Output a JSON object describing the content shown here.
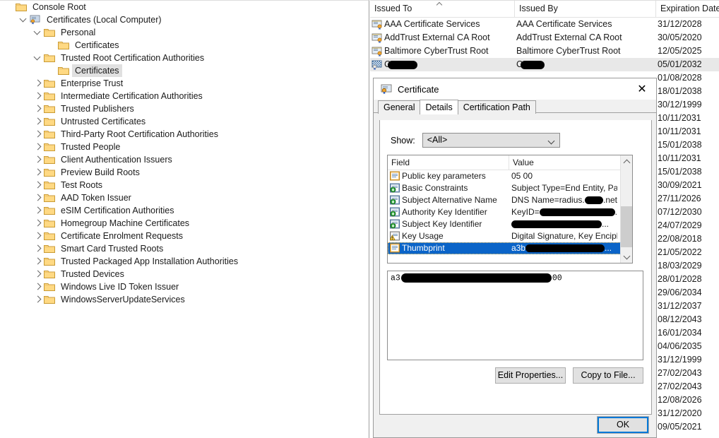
{
  "tree": {
    "items": [
      {
        "label": "Console Root",
        "depth": 0,
        "toggle": "none",
        "icon": "folder-icon",
        "selected": false
      },
      {
        "label": "Certificates (Local Computer)",
        "depth": 1,
        "toggle": "expanded",
        "icon": "console-certificates-icon",
        "selected": false
      },
      {
        "label": "Personal",
        "depth": 2,
        "toggle": "expanded",
        "icon": "folder-icon",
        "selected": false
      },
      {
        "label": "Certificates",
        "depth": 3,
        "toggle": "none",
        "icon": "folder-icon",
        "selected": false
      },
      {
        "label": "Trusted Root Certification Authorities",
        "depth": 2,
        "toggle": "expanded",
        "icon": "folder-icon",
        "selected": false
      },
      {
        "label": "Certificates",
        "depth": 3,
        "toggle": "none",
        "icon": "folder-icon",
        "selected": true
      },
      {
        "label": "Enterprise Trust",
        "depth": 2,
        "toggle": "collapsed",
        "icon": "folder-icon",
        "selected": false
      },
      {
        "label": "Intermediate Certification Authorities",
        "depth": 2,
        "toggle": "collapsed",
        "icon": "folder-icon",
        "selected": false
      },
      {
        "label": "Trusted Publishers",
        "depth": 2,
        "toggle": "collapsed",
        "icon": "folder-icon",
        "selected": false
      },
      {
        "label": "Untrusted Certificates",
        "depth": 2,
        "toggle": "collapsed",
        "icon": "folder-icon",
        "selected": false
      },
      {
        "label": "Third-Party Root Certification Authorities",
        "depth": 2,
        "toggle": "collapsed",
        "icon": "folder-icon",
        "selected": false
      },
      {
        "label": "Trusted People",
        "depth": 2,
        "toggle": "collapsed",
        "icon": "folder-icon",
        "selected": false
      },
      {
        "label": "Client Authentication Issuers",
        "depth": 2,
        "toggle": "collapsed",
        "icon": "folder-icon",
        "selected": false
      },
      {
        "label": "Preview Build Roots",
        "depth": 2,
        "toggle": "collapsed",
        "icon": "folder-icon",
        "selected": false
      },
      {
        "label": "Test Roots",
        "depth": 2,
        "toggle": "collapsed",
        "icon": "folder-icon",
        "selected": false
      },
      {
        "label": "AAD Token Issuer",
        "depth": 2,
        "toggle": "collapsed",
        "icon": "folder-icon",
        "selected": false
      },
      {
        "label": "eSIM Certification Authorities",
        "depth": 2,
        "toggle": "collapsed",
        "icon": "folder-icon",
        "selected": false
      },
      {
        "label": "Homegroup Machine Certificates",
        "depth": 2,
        "toggle": "collapsed",
        "icon": "folder-icon",
        "selected": false
      },
      {
        "label": "Certificate Enrolment Requests",
        "depth": 2,
        "toggle": "collapsed",
        "icon": "folder-icon",
        "selected": false
      },
      {
        "label": "Smart Card Trusted Roots",
        "depth": 2,
        "toggle": "collapsed",
        "icon": "folder-icon",
        "selected": false
      },
      {
        "label": "Trusted Packaged App Installation Authorities",
        "depth": 2,
        "toggle": "collapsed",
        "icon": "folder-icon",
        "selected": false
      },
      {
        "label": "Trusted Devices",
        "depth": 2,
        "toggle": "collapsed",
        "icon": "folder-icon",
        "selected": false
      },
      {
        "label": "Windows Live ID Token Issuer",
        "depth": 2,
        "toggle": "collapsed",
        "icon": "folder-icon",
        "selected": false
      },
      {
        "label": "WindowsServerUpdateServices",
        "depth": 2,
        "toggle": "collapsed",
        "icon": "folder-icon",
        "selected": false
      }
    ]
  },
  "list": {
    "columns": [
      "Issued To",
      "Issued By",
      "Expiration Date"
    ],
    "sort_column": "Issued To",
    "sort_direction": "ascending",
    "rows": [
      {
        "issued_to": "AAA Certificate Services",
        "issued_by": "AAA Certificate Services",
        "expiration": "31/12/2028",
        "selected": false,
        "redacted": false
      },
      {
        "issued_to": "AddTrust External CA Root",
        "issued_by": "AddTrust External CA Root",
        "expiration": "30/05/2020",
        "selected": false,
        "redacted": false
      },
      {
        "issued_to": "Baltimore CyberTrust Root",
        "issued_by": "Baltimore CyberTrust Root",
        "expiration": "12/05/2025",
        "selected": false,
        "redacted": false
      },
      {
        "issued_to": "C",
        "issued_by": "C",
        "expiration": "05/01/2032",
        "selected": true,
        "redacted": true
      },
      {
        "issued_to": "",
        "issued_by": "",
        "expiration": "01/08/2028",
        "selected": false,
        "redacted": false
      },
      {
        "issued_to": "",
        "issued_by": "",
        "expiration": "18/01/2038",
        "selected": false,
        "redacted": false
      },
      {
        "issued_to": "",
        "issued_by": "",
        "expiration": "30/12/1999",
        "selected": false,
        "redacted": false
      },
      {
        "issued_to": "",
        "issued_by": "",
        "expiration": "10/11/2031",
        "selected": false,
        "redacted": false
      },
      {
        "issued_to": "",
        "issued_by": "",
        "expiration": "10/11/2031",
        "selected": false,
        "redacted": false
      },
      {
        "issued_to": "",
        "issued_by": "",
        "expiration": "15/01/2038",
        "selected": false,
        "redacted": false
      },
      {
        "issued_to": "",
        "issued_by": "",
        "expiration": "10/11/2031",
        "selected": false,
        "redacted": false
      },
      {
        "issued_to": "",
        "issued_by": "",
        "expiration": "15/01/2038",
        "selected": false,
        "redacted": false
      },
      {
        "issued_to": "",
        "issued_by": "",
        "expiration": "30/09/2021",
        "selected": false,
        "redacted": false
      },
      {
        "issued_to": "",
        "issued_by": "",
        "expiration": "27/11/2026",
        "selected": false,
        "redacted": false
      },
      {
        "issued_to": "",
        "issued_by": "",
        "expiration": "07/12/2030",
        "selected": false,
        "redacted": false
      },
      {
        "issued_to": "",
        "issued_by": "",
        "expiration": "24/07/2029",
        "selected": false,
        "redacted": false
      },
      {
        "issued_to": "",
        "issued_by": "",
        "expiration": "22/08/2018",
        "selected": false,
        "redacted": false
      },
      {
        "issued_to": "",
        "issued_by": "",
        "expiration": "21/05/2022",
        "selected": false,
        "redacted": false
      },
      {
        "issued_to": "",
        "issued_by": "",
        "expiration": "18/03/2029",
        "selected": false,
        "redacted": false
      },
      {
        "issued_to": "",
        "issued_by": "",
        "expiration": "28/01/2028",
        "selected": false,
        "redacted": false
      },
      {
        "issued_to": "",
        "issued_by": "",
        "expiration": "29/06/2034",
        "selected": false,
        "redacted": false
      },
      {
        "issued_to": "",
        "issued_by": "",
        "expiration": "31/12/2037",
        "selected": false,
        "redacted": false
      },
      {
        "issued_to": "",
        "issued_by": "",
        "expiration": "08/12/2043",
        "selected": false,
        "redacted": false
      },
      {
        "issued_to": "",
        "issued_by": "",
        "expiration": "16/01/2034",
        "selected": false,
        "redacted": false
      },
      {
        "issued_to": "",
        "issued_by": "",
        "expiration": "04/06/2035",
        "selected": false,
        "redacted": false
      },
      {
        "issued_to": "",
        "issued_by": "",
        "expiration": "31/12/1999",
        "selected": false,
        "redacted": false
      },
      {
        "issued_to": "",
        "issued_by": "",
        "expiration": "27/02/2043",
        "selected": false,
        "redacted": false
      },
      {
        "issued_to": "",
        "issued_by": "",
        "expiration": "27/02/2043",
        "selected": false,
        "redacted": false
      },
      {
        "issued_to": "",
        "issued_by": "",
        "expiration": "12/08/2026",
        "selected": false,
        "redacted": false
      },
      {
        "issued_to": "",
        "issued_by": "",
        "expiration": "31/12/2020",
        "selected": false,
        "redacted": false
      },
      {
        "issued_to": "",
        "issued_by": "",
        "expiration": "09/05/2021",
        "selected": false,
        "redacted": false
      }
    ]
  },
  "dialog": {
    "title": "Certificate",
    "close_label": "✕",
    "tabs": [
      {
        "label": "General",
        "active": false
      },
      {
        "label": "Details",
        "active": true
      },
      {
        "label": "Certification Path",
        "active": false
      }
    ],
    "show_label": "Show:",
    "show_value": "<All>",
    "field_columns": [
      "Field",
      "Value"
    ],
    "fields": [
      {
        "field": "Public key parameters",
        "value": "05 00",
        "icon": "document-icon",
        "selected": false,
        "redacted": false
      },
      {
        "field": "Basic Constraints",
        "value": "Subject Type=End Entity, Pat...",
        "icon": "extension-icon",
        "selected": false,
        "redacted": false
      },
      {
        "field": "Subject Alternative Name",
        "value": "DNS Name=radius.",
        "value_suffix": ".net",
        "icon": "extension-icon",
        "selected": false,
        "redacted": true
      },
      {
        "field": "Authority Key Identifier",
        "value": "KeyID=",
        "value_suffix": ".",
        "icon": "extension-icon",
        "selected": false,
        "redacted": true
      },
      {
        "field": "Subject Key Identifier",
        "value": "",
        "value_suffix": "...",
        "icon": "extension-icon",
        "selected": false,
        "redacted": true
      },
      {
        "field": "Key Usage",
        "value": "Digital Signature, Key Encipher...",
        "icon": "warning-icon",
        "selected": false,
        "redacted": false
      },
      {
        "field": "Thumbprint",
        "value": "a3b",
        "value_suffix": "...",
        "icon": "document-icon",
        "selected": true,
        "redacted": true
      }
    ],
    "value_box": {
      "prefix": "a3",
      "suffix": "00"
    },
    "buttons": {
      "edit_properties": "Edit Properties...",
      "copy_to_file": "Copy to File...",
      "ok": "OK"
    }
  },
  "colors": {
    "selection_blue": "#0a64c8",
    "focus_blue": "#0078d7",
    "row_selected_gray": "#e8e8e8",
    "dialog_bg": "#f0f0f0",
    "folder_gold": "#ffd27f"
  }
}
